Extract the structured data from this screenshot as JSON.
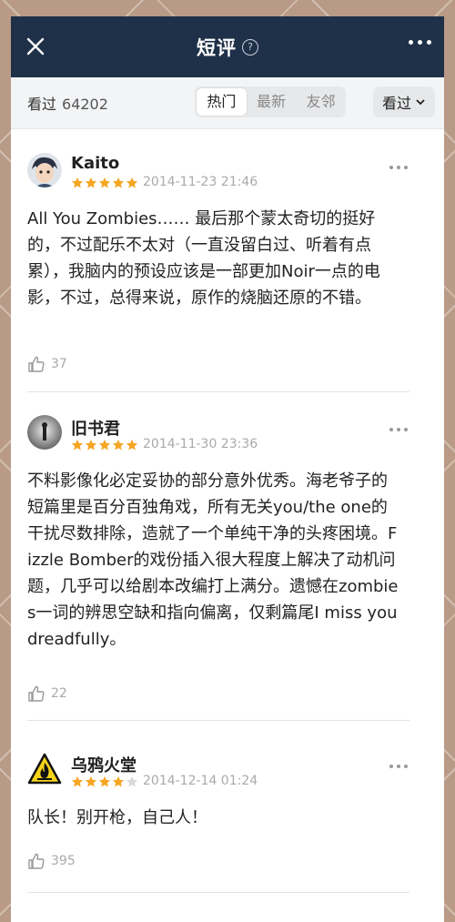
{
  "header": {
    "title": "短评",
    "close_icon": "close-icon",
    "help_icon": "help-icon",
    "more_icon": "more-dots-icon"
  },
  "filters": {
    "seen_label": "看过",
    "seen_count": "64202",
    "tabs": [
      {
        "label": "热门",
        "active": true
      },
      {
        "label": "最新",
        "active": false
      },
      {
        "label": "友邻",
        "active": false
      }
    ],
    "dropdown_label": "看过"
  },
  "colors": {
    "header_bg": "#1f3049",
    "star": "#f5a623",
    "star_empty": "#d8d8d8"
  },
  "reviews": [
    {
      "user": "Kaito",
      "rating": 5,
      "date": "2014-11-23 21:46",
      "content": "All You Zombies…… 最后那个蒙太奇切的挺好的，不过配乐不太对（一直没留白过、听着有点累），我脑内的预设应该是一部更加Noir一点的电影，不过，总得来说，原作的烧脑还原的不错。",
      "likes": "37"
    },
    {
      "user": "旧书君",
      "rating": 5,
      "date": "2014-11-30 23:36",
      "content": "不料影像化必定妥协的部分意外优秀。海老爷子的短篇里是百分百独角戏，所有无关you/the one的干扰尽数排除，造就了一个单纯干净的头疼困境。Fizzle Bomber的戏份插入很大程度上解决了动机问题，几乎可以给剧本改编打上满分。遗憾在zombies一词的辨思空缺和指向偏离，仅剩篇尾I miss you dreadfully。",
      "likes": "22"
    },
    {
      "user": "乌鸦火堂",
      "rating": 4,
      "date": "2014-12-14 01:24",
      "content": "队长！别开枪，自己人！",
      "likes": "395"
    }
  ]
}
